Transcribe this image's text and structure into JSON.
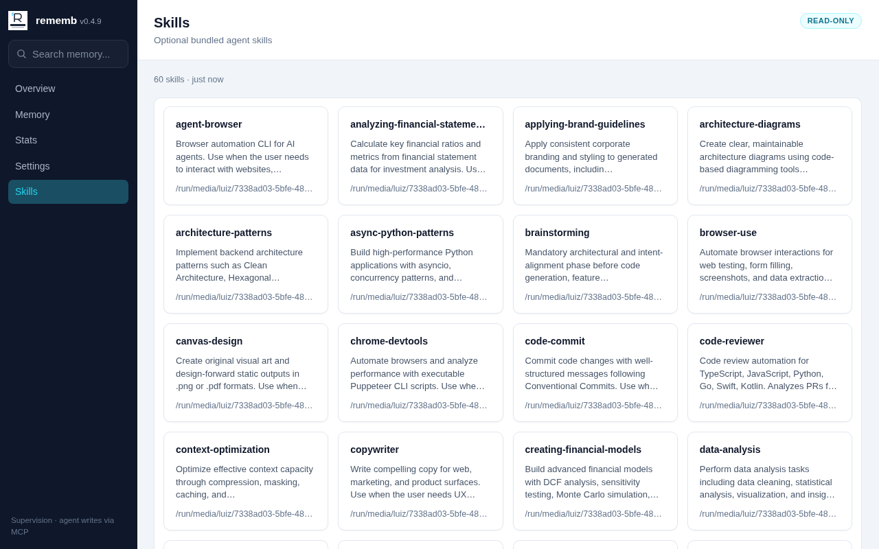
{
  "brand": {
    "name": "rememb",
    "version": "v0.4.9"
  },
  "search": {
    "placeholder": "Search memory..."
  },
  "nav": [
    {
      "label": "Overview",
      "selected": false
    },
    {
      "label": "Memory",
      "selected": false
    },
    {
      "label": "Stats",
      "selected": false
    },
    {
      "label": "Settings",
      "selected": false
    },
    {
      "label": "Skills",
      "selected": true
    }
  ],
  "sidebar_footer": "Supervision · agent writes via MCP",
  "header": {
    "title": "Skills",
    "subtitle": "Optional bundled agent skills",
    "badge": "READ-ONLY"
  },
  "summary": "60 skills · just now",
  "skills": [
    {
      "name": "agent-browser",
      "description": "Browser automation CLI for AI agents. Use when the user needs to interact with websites,…",
      "path": "/run/media/luiz/7338ad03-5bfe-48…"
    },
    {
      "name": "analyzing-financial-stateme…",
      "description": "Calculate key financial ratios and metrics from financial statement data for investment analysis. Us…",
      "path": "/run/media/luiz/7338ad03-5bfe-48…"
    },
    {
      "name": "applying-brand-guidelines",
      "description": "Apply consistent corporate branding and styling to generated documents, includin…",
      "path": "/run/media/luiz/7338ad03-5bfe-48…"
    },
    {
      "name": "architecture-diagrams",
      "description": "Create clear, maintainable architecture diagrams using code-based diagramming tools…",
      "path": "/run/media/luiz/7338ad03-5bfe-48…"
    },
    {
      "name": "architecture-patterns",
      "description": "Implement backend architecture patterns such as Clean Architecture, Hexagonal…",
      "path": "/run/media/luiz/7338ad03-5bfe-48…"
    },
    {
      "name": "async-python-patterns",
      "description": "Build high-performance Python applications with asyncio, concurrency patterns, and…",
      "path": "/run/media/luiz/7338ad03-5bfe-48…"
    },
    {
      "name": "brainstorming",
      "description": "Mandatory architectural and intent-alignment phase before code generation, feature…",
      "path": "/run/media/luiz/7338ad03-5bfe-48…"
    },
    {
      "name": "browser-use",
      "description": "Automate browser interactions for web testing, form filling, screenshots, and data extractio…",
      "path": "/run/media/luiz/7338ad03-5bfe-48…"
    },
    {
      "name": "canvas-design",
      "description": "Create original visual art and design-forward static outputs in .png or .pdf formats. Use when…",
      "path": "/run/media/luiz/7338ad03-5bfe-48…"
    },
    {
      "name": "chrome-devtools",
      "description": "Automate browsers and analyze performance with executable Puppeteer CLI scripts. Use whe…",
      "path": "/run/media/luiz/7338ad03-5bfe-48…"
    },
    {
      "name": "code-commit",
      "description": "Commit code changes with well-structured messages following Conventional Commits. Use wh…",
      "path": "/run/media/luiz/7338ad03-5bfe-48…"
    },
    {
      "name": "code-reviewer",
      "description": "Code review automation for TypeScript, JavaScript, Python, Go, Swift, Kotlin. Analyzes PRs f…",
      "path": "/run/media/luiz/7338ad03-5bfe-48…"
    },
    {
      "name": "context-optimization",
      "description": "Optimize effective context capacity through compression, masking, caching, and…",
      "path": "/run/media/luiz/7338ad03-5bfe-48…"
    },
    {
      "name": "copywriter",
      "description": "Write compelling copy for web, marketing, and product surfaces. Use when the user needs UX…",
      "path": "/run/media/luiz/7338ad03-5bfe-48…"
    },
    {
      "name": "creating-financial-models",
      "description": "Build advanced financial models with DCF analysis, sensitivity testing, Monte Carlo simulation,…",
      "path": "/run/media/luiz/7338ad03-5bfe-48…"
    },
    {
      "name": "data-analysis",
      "description": "Perform data analysis tasks including data cleaning, statistical analysis, visualization, and insig…",
      "path": "/run/media/luiz/7338ad03-5bfe-48…"
    }
  ],
  "more_below": true
}
